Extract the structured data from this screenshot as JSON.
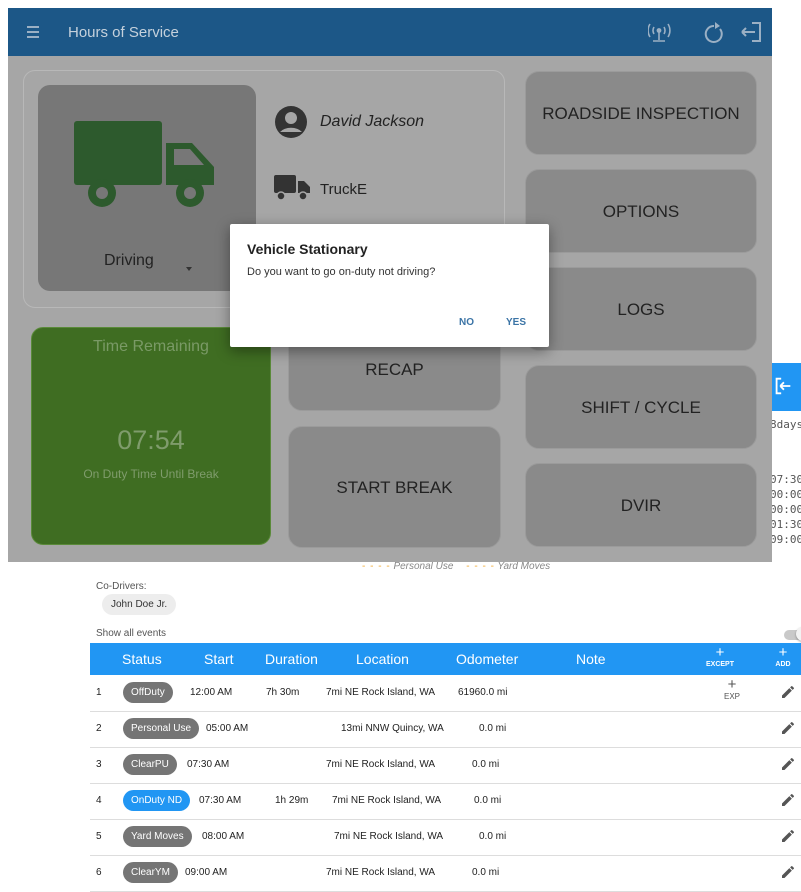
{
  "front": {
    "app_title": "Hours of Service",
    "driver_name": "David Jackson",
    "truck_name": "TruckE",
    "duty_status": "Driving",
    "time_remaining": {
      "title": "Time Remaining",
      "value": "07:54",
      "caption": "On Duty Time Until Break"
    },
    "buttons": {
      "roadside": "ROADSIDE INSPECTION",
      "options": "OPTIONS",
      "logs": "LOGS",
      "recap": "RECAP",
      "shift_cycle": "SHIFT / CYCLE",
      "start_break": "START BREAK",
      "dvir": "DVIR"
    },
    "dialog": {
      "title": "Vehicle Stationary",
      "message": "Do you want to go on-duty not driving?",
      "no": "NO",
      "yes": "YES"
    },
    "colors": {
      "app_bar": "#1c5787",
      "time_card": "#3f6d22",
      "dialog_button": "#3b74a6"
    }
  },
  "back": {
    "side_text": [
      "8days",
      "07:30",
      "00:00",
      "00:00",
      "01:30",
      "09:00"
    ],
    "legend": {
      "personal_use": "Personal Use",
      "yard_moves": "Yard Moves"
    },
    "co_drivers_label": "Co-Drivers:",
    "co_driver": "John Doe Jr.",
    "show_all_events": "Show all events",
    "table": {
      "headers": {
        "status": "Status",
        "start": "Start",
        "duration": "Duration",
        "location": "Location",
        "odometer": "Odometer",
        "note": "Note",
        "except": "EXCEPT",
        "add": "ADD"
      },
      "exp_label": "EXP",
      "rows": [
        {
          "num": "1",
          "status": "OffDuty",
          "start": "12:00 AM",
          "duration": "7h 30m",
          "location": "7mi NE Rock Island, WA",
          "odometer": "61960.0 mi"
        },
        {
          "num": "2",
          "status": "Personal Use",
          "start": "05:00 AM",
          "duration": "",
          "location": "13mi NNW Quincy, WA",
          "odometer": "0.0 mi"
        },
        {
          "num": "3",
          "status": "ClearPU",
          "start": "07:30 AM",
          "duration": "",
          "location": "7mi NE Rock Island, WA",
          "odometer": "0.0 mi"
        },
        {
          "num": "4",
          "status": "OnDuty ND",
          "start": "07:30 AM",
          "duration": "1h 29m",
          "location": "7mi NE Rock Island, WA",
          "odometer": "0.0 mi"
        },
        {
          "num": "5",
          "status": "Yard Moves",
          "start": "08:00 AM",
          "duration": "",
          "location": "7mi NE Rock Island, WA",
          "odometer": "0.0 mi"
        },
        {
          "num": "6",
          "status": "ClearYM",
          "start": "09:00 AM",
          "duration": "",
          "location": "7mi NE Rock Island, WA",
          "odometer": "0.0 mi"
        }
      ]
    },
    "colors": {
      "header": "#2196f3",
      "chip": "#757575",
      "chip_active": "#2196f3"
    }
  }
}
